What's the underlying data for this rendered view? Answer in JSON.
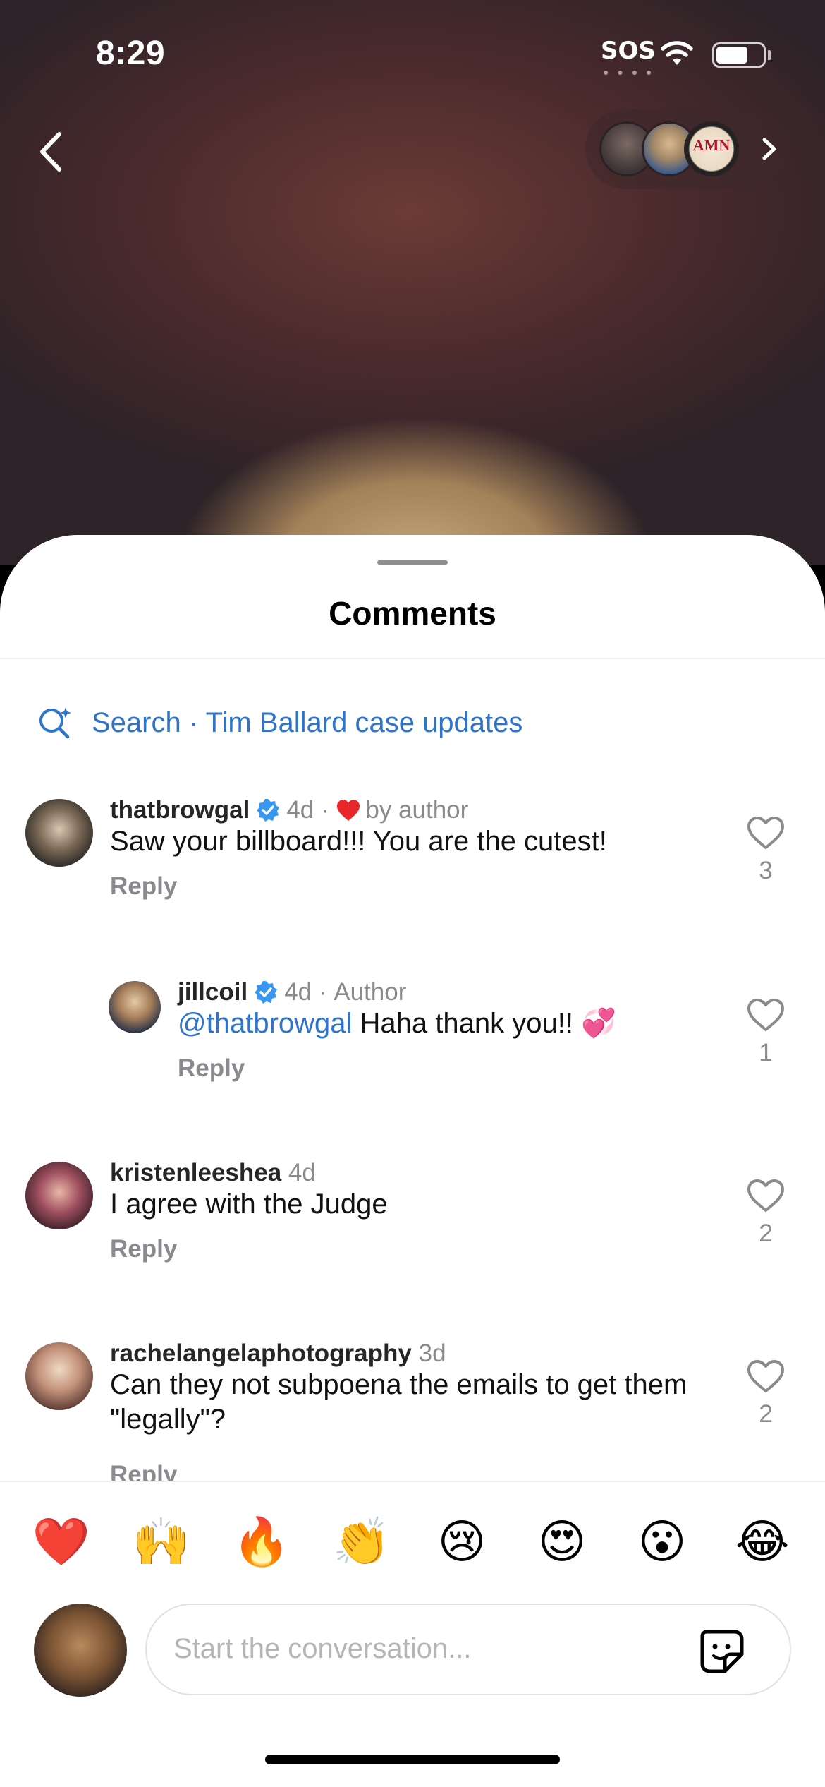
{
  "status_bar": {
    "time": "8:29",
    "sos": "SOS"
  },
  "sheet": {
    "title": "Comments",
    "search": "Search · Tim Ballard case updates"
  },
  "comments": [
    {
      "user": "thatbrowgal",
      "verified": true,
      "meta_time": "4d",
      "meta_extra": "by author",
      "liked_by_author": true,
      "text": "Saw your billboard!!! You are the cutest!",
      "reply": "Reply",
      "likes": "3"
    },
    {
      "user": "jillcoil",
      "verified": true,
      "meta_time": "4d",
      "meta_extra": "Author",
      "mention": "@thatbrowgal",
      "text": "Haha thank you!! 💞",
      "reply": "Reply",
      "likes": "1"
    },
    {
      "user": "kristenleeshea",
      "verified": false,
      "meta_time": "4d",
      "text": "I agree with the Judge",
      "reply": "Reply",
      "likes": "2"
    },
    {
      "user": "rachelangelaphotography",
      "verified": false,
      "meta_time": "3d",
      "text": "Can they not subpoena the emails to get them \"legally\"?",
      "reply": "Reply",
      "likes": "2"
    }
  ],
  "story_pill": {
    "badge_text": "AMN"
  },
  "emojis": [
    "❤️",
    "🙌",
    "🔥",
    "👏",
    "😢",
    "😍",
    "😮",
    "😂"
  ],
  "composer": {
    "placeholder": "Start the conversation..."
  },
  "colors": {
    "accent": "#2f74c8",
    "like_red": "#e8272b"
  }
}
